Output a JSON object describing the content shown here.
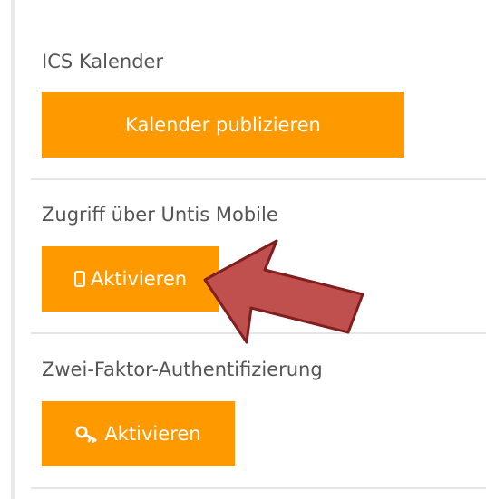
{
  "ics": {
    "label": "ICS Kalender",
    "button_label": "Kalender publizieren"
  },
  "untis_mobile": {
    "label": "Zugriff über Untis Mobile",
    "button_label": "Aktivieren",
    "button_icon": "mobile-phone-icon"
  },
  "two_factor": {
    "label": "Zwei-Faktor-Authentifizierung",
    "button_label": "Aktivieren",
    "button_icon": "key-icon"
  },
  "colors": {
    "button_bg": "#ff9900",
    "button_text": "#ffffff",
    "label_text": "#555555",
    "annotation_arrow": "#c0504d"
  }
}
